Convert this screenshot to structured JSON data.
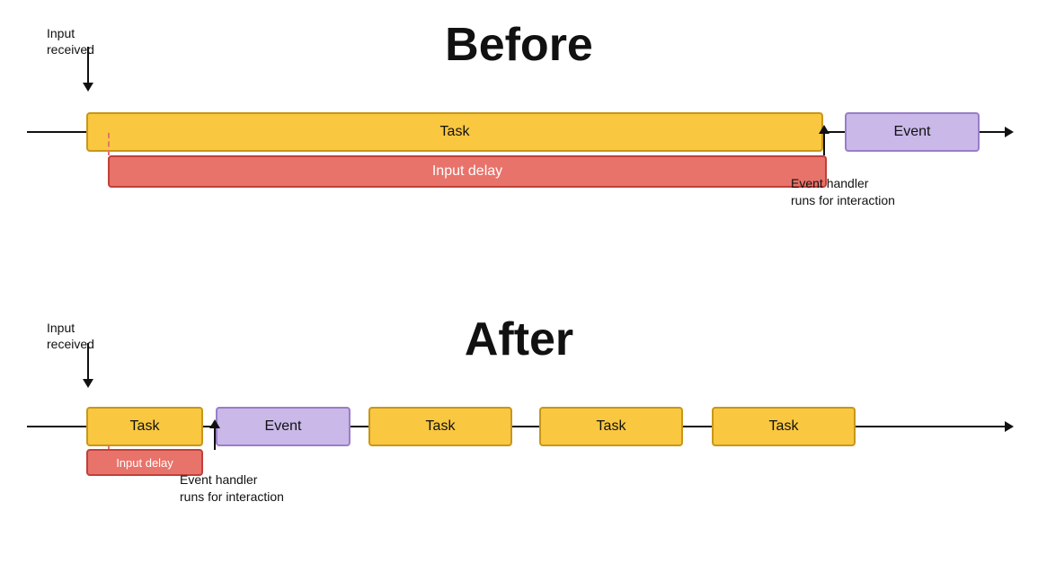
{
  "before": {
    "title": "Before",
    "input_received": "Input\nreceived",
    "task_label": "Task",
    "event_label": "Event",
    "input_delay_label": "Input delay",
    "event_handler_label": "Event handler\nruns for interaction"
  },
  "after": {
    "title": "After",
    "input_received": "Input\nreceived",
    "task_label": "Task",
    "event_label": "Event",
    "input_delay_label": "Input delay",
    "event_handler_label": "Event handler\nruns for interaction",
    "task2_label": "Task",
    "task3_label": "Task",
    "task4_label": "Task"
  }
}
